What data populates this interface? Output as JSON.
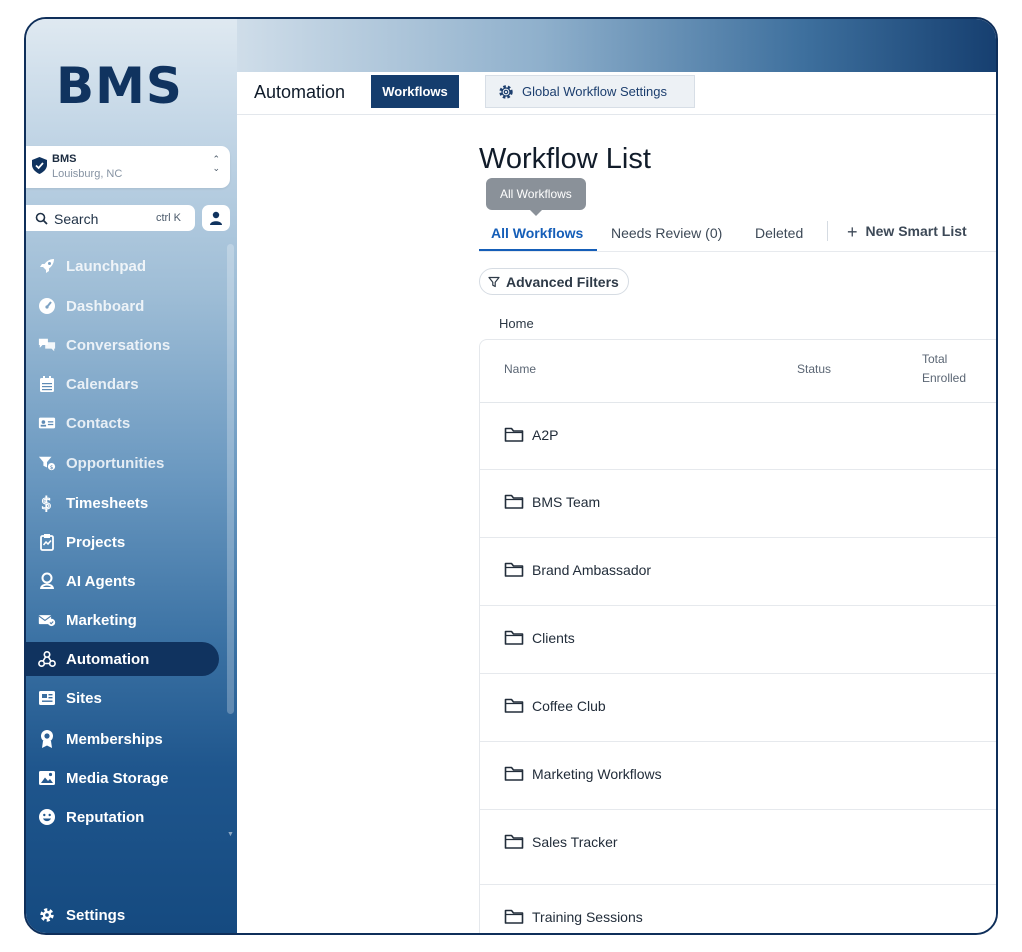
{
  "sidebar": {
    "logo": "BMS",
    "location": {
      "name": "BMS",
      "city": "Louisburg, NC"
    },
    "search": {
      "label": "Search",
      "shortcut": "ctrl K"
    },
    "items": [
      {
        "label": "Launchpad",
        "icon": "rocket-icon",
        "name": "launchpad"
      },
      {
        "label": "Dashboard",
        "icon": "gauge-icon",
        "name": "dashboard"
      },
      {
        "label": "Conversations",
        "icon": "chat-icon",
        "name": "conversations"
      },
      {
        "label": "Calendars",
        "icon": "calendar-icon",
        "name": "calendars"
      },
      {
        "label": "Contacts",
        "icon": "id-card-icon",
        "name": "contacts"
      },
      {
        "label": "Opportunities",
        "icon": "funnel-icon",
        "name": "opportunities"
      },
      {
        "label": "Timesheets",
        "icon": "dollar-icon",
        "name": "timesheets"
      },
      {
        "label": "Projects",
        "icon": "clipboard-icon",
        "name": "projects"
      },
      {
        "label": "AI Agents",
        "icon": "agent-icon",
        "name": "ai-agents"
      },
      {
        "label": "Marketing",
        "icon": "mail-icon",
        "name": "marketing"
      },
      {
        "label": "Automation",
        "icon": "workflow-icon",
        "name": "automation",
        "active": true
      },
      {
        "label": "Sites",
        "icon": "browser-icon",
        "name": "sites"
      },
      {
        "label": "Memberships",
        "icon": "award-icon",
        "name": "memberships"
      },
      {
        "label": "Media Storage",
        "icon": "image-icon",
        "name": "media-storage"
      },
      {
        "label": "Reputation",
        "icon": "smile-icon",
        "name": "reputation"
      }
    ],
    "settings": "Settings"
  },
  "topbar": {
    "module": "Automation",
    "active_tab": "Workflows",
    "global_settings": "Global Workflow Settings"
  },
  "main": {
    "title": "Workflow List",
    "tooltip": "All Workflows",
    "tabs": {
      "all": "All Workflows",
      "review": "Needs Review (0)",
      "deleted": "Deleted"
    },
    "new_smart_list": "New Smart List",
    "filters": "Advanced Filters",
    "breadcrumb": "Home",
    "columns": {
      "name": "Name",
      "status": "Status",
      "total": "Total Enrolled"
    },
    "folders": [
      "A2P",
      "BMS Team",
      "Brand Ambassador",
      "Clients",
      "Coffee Club",
      "Marketing Workflows",
      "Sales Tracker",
      "Training Sessions"
    ]
  },
  "colors": {
    "brand_navy": "#10335f",
    "accent_blue": "#155eb8",
    "tab_bg": "#153d6d"
  }
}
